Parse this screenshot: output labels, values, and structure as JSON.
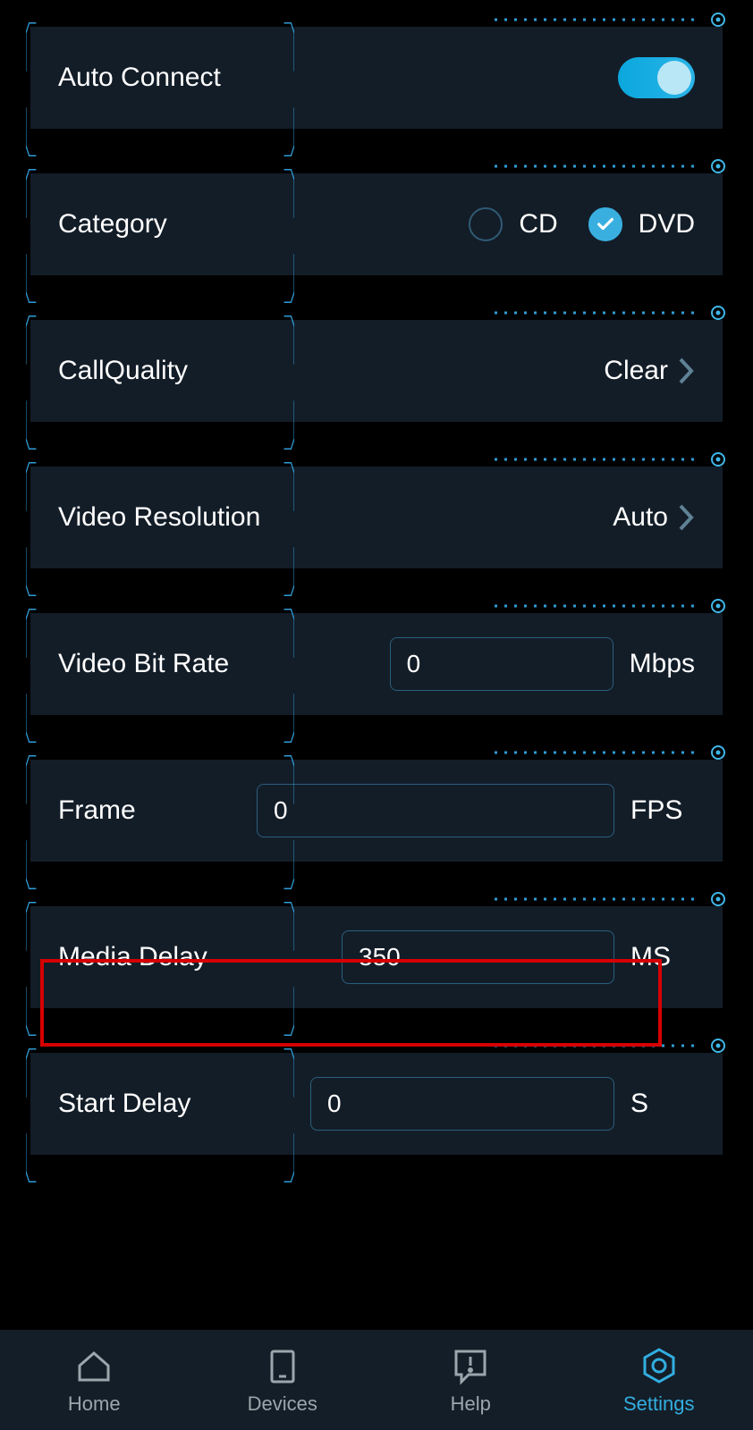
{
  "settings": {
    "autoConnect": {
      "label": "Auto Connect",
      "on": true
    },
    "category": {
      "label": "Category",
      "options": [
        {
          "label": "CD",
          "checked": false
        },
        {
          "label": "DVD",
          "checked": true
        }
      ]
    },
    "callQuality": {
      "label": "CallQuality",
      "value": "Clear"
    },
    "videoResolution": {
      "label": "Video Resolution",
      "value": "Auto"
    },
    "videoBitRate": {
      "label": "Video Bit Rate",
      "value": "0",
      "unit": "Mbps"
    },
    "frame": {
      "label": "Frame",
      "value": "0",
      "unit": "FPS"
    },
    "mediaDelay": {
      "label": "Media Delay",
      "value": "350",
      "unit": "MS"
    },
    "startDelay": {
      "label": "Start Delay",
      "value": "0",
      "unit": "S"
    }
  },
  "tabs": {
    "home": "Home",
    "devices": "Devices",
    "help": "Help",
    "settings": "Settings"
  }
}
